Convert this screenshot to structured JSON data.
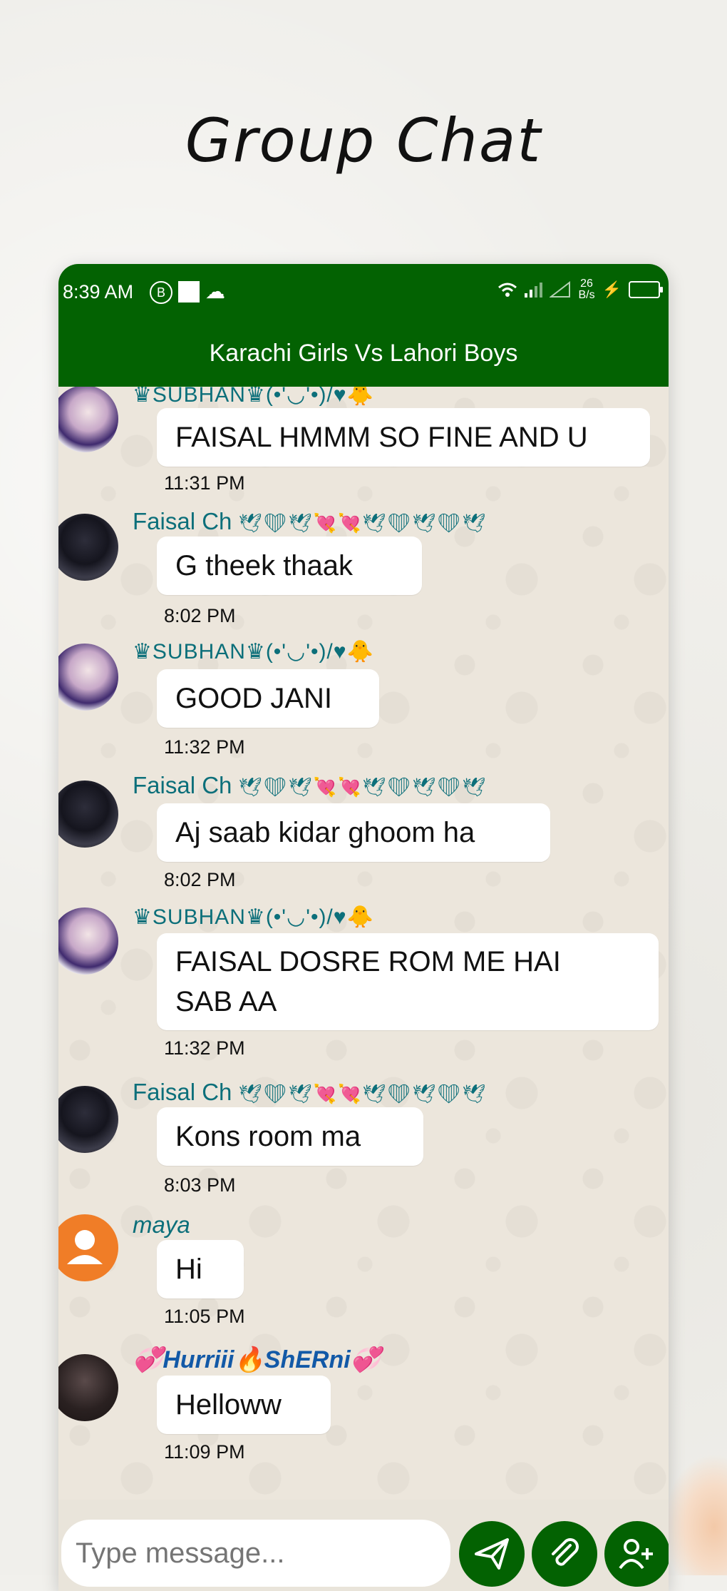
{
  "heading": "Group Chat",
  "status_bar": {
    "time": "8:39 AM",
    "b_icon": "B",
    "speed_top": "26",
    "speed_bottom": "B/s",
    "icons": [
      "wifi-icon",
      "signal-icon",
      "battery-icon",
      "cloud-icon"
    ]
  },
  "app_bar": {
    "title": "Karachi Girls Vs Lahori Boys"
  },
  "messages": [
    {
      "sender": "♛SUBHAN♛(•'◡'•)/♥🐥",
      "text": "FAISAL HMMM SO FINE AND U",
      "time": "11:31 PM"
    },
    {
      "sender": "Faisal Ch",
      "sender_emoji": "🕊❤🕊💘💘🕊❤🕊❤🕊",
      "text": "G theek thaak",
      "time": "8:02 PM"
    },
    {
      "sender": "♛SUBHAN♛(•'◡'•)/♥🐥",
      "text": "GOOD JANI",
      "time": "11:32 PM"
    },
    {
      "sender": "Faisal Ch",
      "sender_emoji": "🕊❤🕊💘💘🕊❤🕊❤🕊",
      "text": "Aj saab kidar ghoom ha",
      "time": "8:02 PM"
    },
    {
      "sender": "♛SUBHAN♛(•'◡'•)/♥🐥",
      "text": "FAISAL DOSRE ROM ME HAI SAB AA",
      "time": "11:32 PM"
    },
    {
      "sender": "Faisal Ch",
      "sender_emoji": "🕊❤🕊💘💘🕊❤🕊❤🕊",
      "text": "Kons room ma",
      "time": "8:03 PM"
    },
    {
      "sender": "maya",
      "text": "Hi",
      "time": "11:05 PM"
    },
    {
      "sender": "💞Hurriii🔥ShERni💞",
      "text": "Helloww",
      "time": "11:09 PM"
    }
  ],
  "input": {
    "placeholder": "Type message..."
  },
  "buttons": {
    "send": "send-icon",
    "attach": "paperclip-icon",
    "add_user": "add-user-icon"
  },
  "colors": {
    "primary": "#036202",
    "bubble": "#ffffff",
    "sender": "#0c6f7a",
    "maya_avatar": "#f07d27"
  }
}
